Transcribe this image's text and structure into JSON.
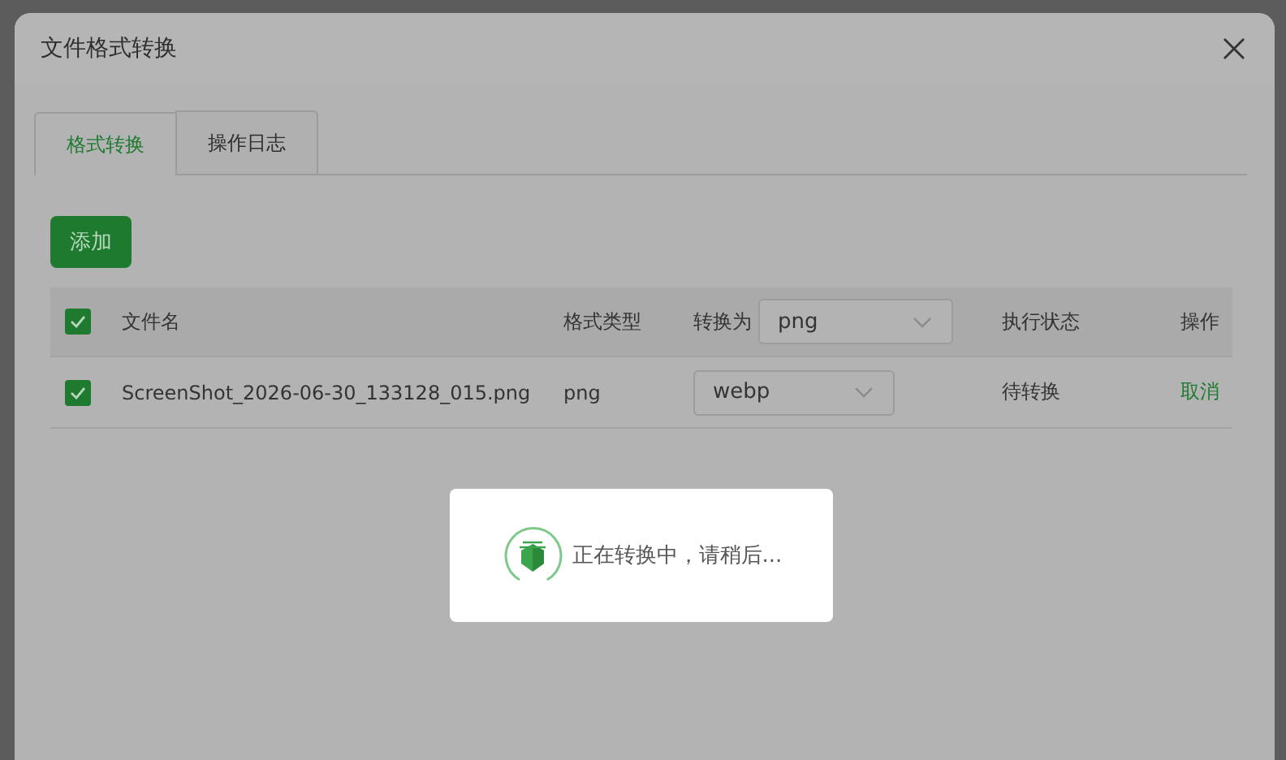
{
  "dialog": {
    "title": "文件格式转换"
  },
  "tabs": [
    {
      "label": "格式转换",
      "selected": true
    },
    {
      "label": "操作日志",
      "selected": false
    }
  ],
  "add_button": "添加",
  "table": {
    "all_checked": true,
    "columns": {
      "file_name": "文件名",
      "format": "格式类型",
      "convert_to": "转换为",
      "convert_to_value": "png",
      "status": "执行状态",
      "action": "操作"
    },
    "rows": [
      {
        "checked": true,
        "file_name": "ScreenShot_2026-06-30_133128_015.png",
        "format": "png",
        "target": "webp",
        "status": "待转换",
        "action": "取消"
      }
    ]
  },
  "loading": {
    "message": "正在转换中，请稍后..."
  }
}
